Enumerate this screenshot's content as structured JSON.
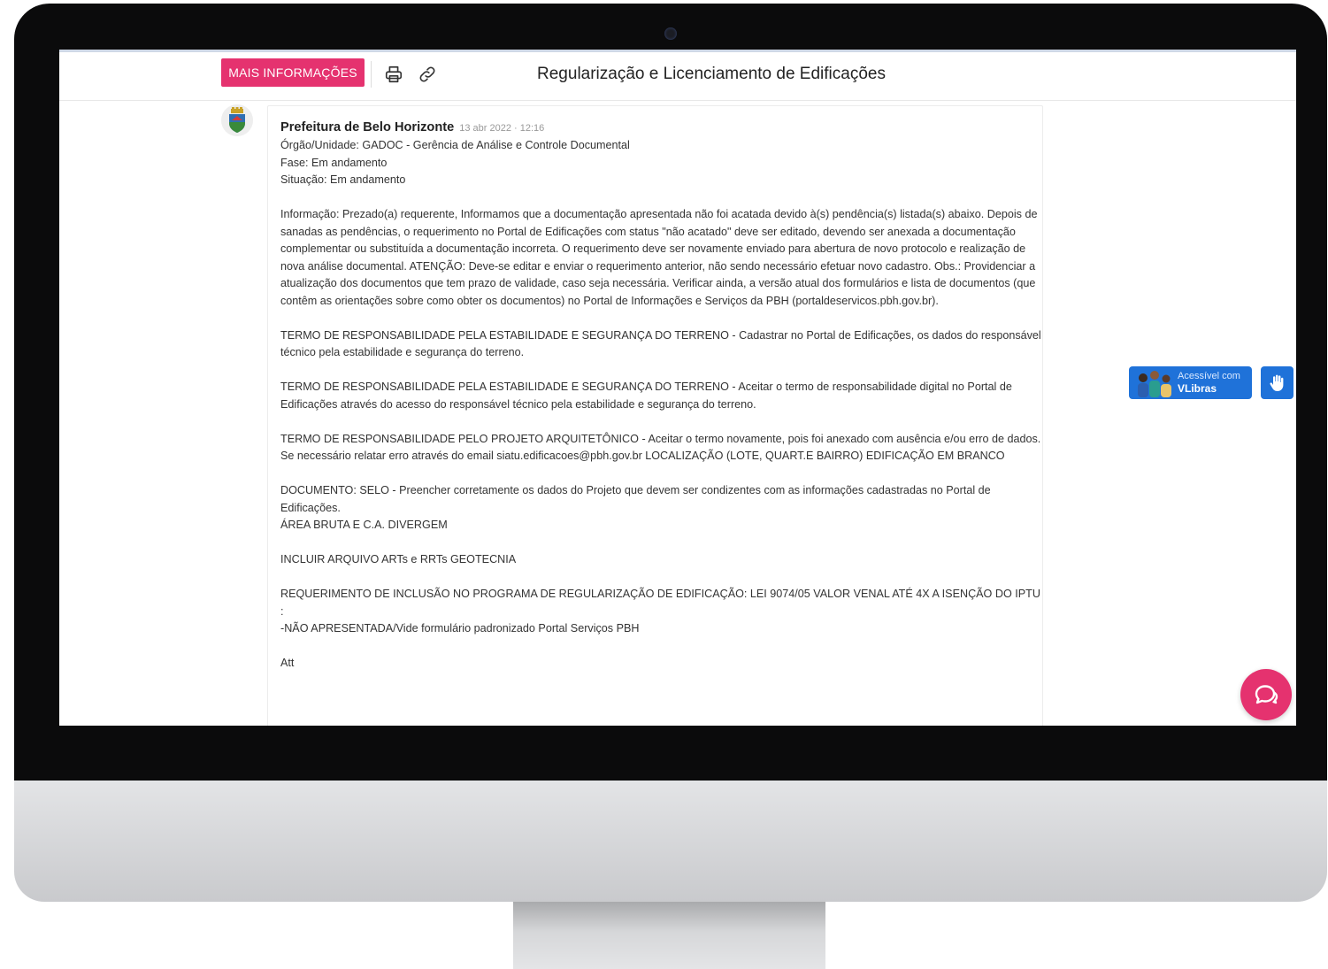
{
  "header": {
    "more_info_label": "MAIS INFORMAÇÕES",
    "title": "Regularização e Licenciamento de Edificações",
    "icons": [
      "printer-icon",
      "link-icon"
    ]
  },
  "message": {
    "author": "Prefeitura de Belo Horizonte",
    "timestamp": "13 abr 2022 · 12:16",
    "orgao": "Órgão/Unidade: GADOC - Gerência de Análise e Controle Documental",
    "fase": "Fase: Em andamento",
    "situacao": "Situação: Em andamento",
    "informacao": "Informação: Prezado(a) requerente, Informamos que a documentação apresentada não foi acatada devido à(s) pendência(s) listada(s) abaixo. Depois de sanadas as pendências, o requerimento no Portal de Edificações com status \"não acatado\" deve ser editado, devendo ser anexada a documentação complementar ou substituída a documentação incorreta. O requerimento deve ser novamente enviado para abertura de novo protocolo e realização de nova análise documental. ATENÇÃO: Deve-se editar e enviar o requerimento anterior, não sendo necessário efetuar novo cadastro. Obs.: Providenciar a atualização dos documentos que tem prazo de validade, caso seja necessária. Verificar ainda, a versão atual dos formulários e lista de documentos (que contêm as orientações sobre como obter os documentos) no Portal de Informações e Serviços da PBH (portaldeservicos.pbh.gov.br).",
    "item1": "TERMO DE RESPONSABILIDADE PELA ESTABILIDADE E SEGURANÇA DO TERRENO - Cadastrar no Portal de Edificações, os dados do responsável técnico pela estabilidade e segurança do terreno.",
    "item2": "TERMO DE RESPONSABILIDADE PELA ESTABILIDADE E SEGURANÇA DO TERRENO - Aceitar o termo de responsabilidade digital no Portal de Edificações através do acesso do responsável técnico pela estabilidade e segurança do terreno.",
    "item3": "TERMO DE RESPONSABILIDADE PELO PROJETO ARQUITETÔNICO - Aceitar o termo novamente, pois foi anexado com ausência e/ou erro de dados. Se necessário relatar erro através do email siatu.edificacoes@pbh.gov.br LOCALIZAÇÃO (LOTE, QUART.E BAIRRO) EDIFICAÇÃO EM BRANCO",
    "item4": "DOCUMENTO: SELO - Preencher corretamente os dados do Projeto que devem ser condizentes com as informações cadastradas no Portal de Edificações.",
    "item4b": "ÁREA BRUTA E C.A. DIVERGEM",
    "item5": "INCLUIR ARQUIVO ARTs e RRTs GEOTECNIA",
    "item6": "REQUERIMENTO DE INCLUSÃO NO PROGRAMA DE REGULARIZAÇÃO DE EDIFICAÇÃO: LEI 9074/05 VALOR VENAL ATÉ 4X A ISENÇÃO DO IPTU :",
    "item6b": "-NÃO APRESENTADA/Vide formulário padronizado Portal Serviços PBH",
    "closing": "Att"
  },
  "widgets": {
    "vlibras_line1": "Acessível com",
    "vlibras_line2": "VLibras",
    "chat_icon": "chat-icon"
  },
  "colors": {
    "accent": "#e5326f",
    "vlibras_blue": "#1f72d9"
  }
}
